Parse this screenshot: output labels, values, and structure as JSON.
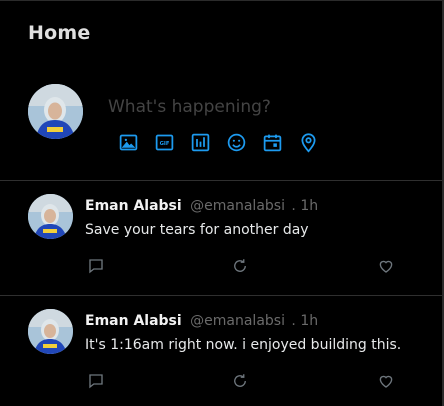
{
  "header": {
    "title": "Home"
  },
  "composer": {
    "placeholder": "What's happening?",
    "tools": [
      "image-icon",
      "gif-icon",
      "poll-icon",
      "emoji-icon",
      "schedule-icon",
      "location-icon"
    ],
    "accent": "#1d9bf0"
  },
  "posts": [
    {
      "name": "Eman Alabsi",
      "handle": "@emanalabsi",
      "time": ". 1h",
      "text": "Save your tears for another day"
    },
    {
      "name": "Eman Alabsi",
      "handle": "@emanalabsi",
      "time": ". 1h",
      "text": "It's 1:16am right now. i enjoyed building this."
    }
  ],
  "colors": {
    "background": "#000000",
    "divider": "#2f2f2f",
    "muted": "#6a6a6a",
    "icon_muted": "#6e767d"
  }
}
